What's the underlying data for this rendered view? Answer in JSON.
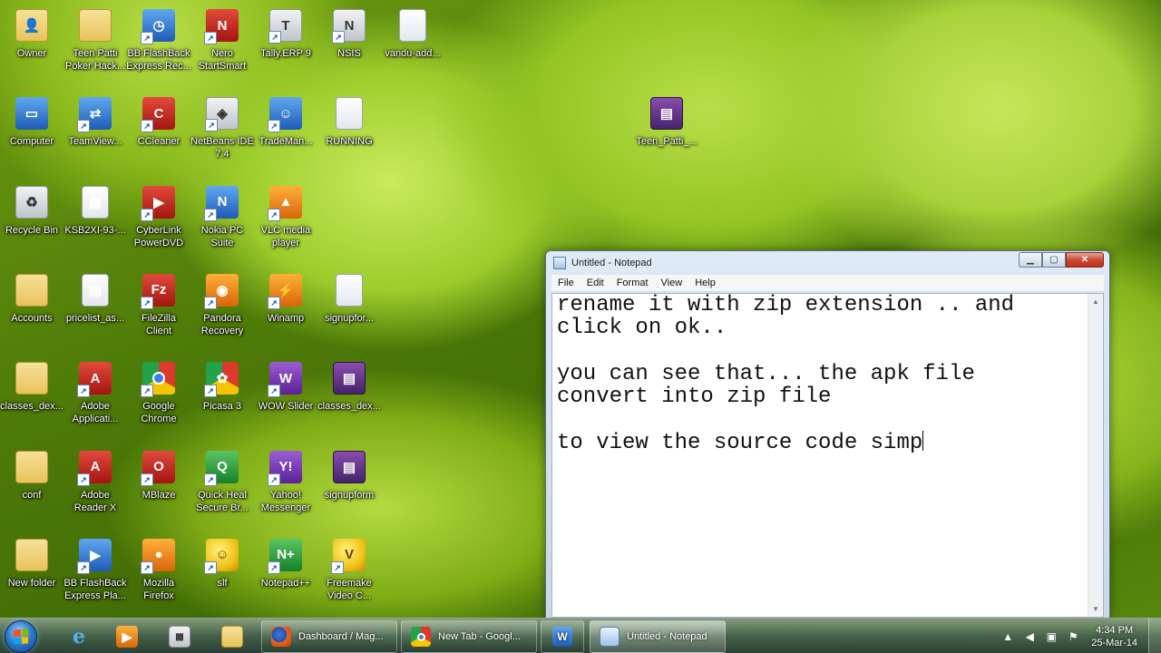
{
  "desktop": {
    "icons": [
      {
        "label": "Owner",
        "icon": "user-folder-icon"
      },
      {
        "label": "Teen Patti\nPoker Hack...",
        "icon": "folder-icon"
      },
      {
        "label": "BB FlashBack\nExpress Rec...",
        "icon": "flashback-recorder-icon"
      },
      {
        "label": "Nero\nStartSmart",
        "icon": "nero-icon"
      },
      {
        "label": "Tally.ERP 9",
        "icon": "tally-icon"
      },
      {
        "label": "NSIS",
        "icon": "nsis-icon"
      },
      {
        "label": "vandu-add...",
        "icon": "text-file-icon"
      },
      {
        "label": "Computer",
        "icon": "computer-icon"
      },
      {
        "label": "TeamView...",
        "icon": "teamviewer-icon"
      },
      {
        "label": "CCleaner",
        "icon": "ccleaner-icon"
      },
      {
        "label": "NetBeans IDE\n7.4",
        "icon": "netbeans-icon"
      },
      {
        "label": "TradeMan...",
        "icon": "trademanager-icon"
      },
      {
        "label": "RUNNING",
        "icon": "text-file-icon"
      },
      {
        "label": "Teen_Patti_...",
        "icon": "winrar-archive-icon"
      },
      {
        "label": "Recycle Bin",
        "icon": "recycle-bin-icon"
      },
      {
        "label": "KSB2XI-93-...",
        "icon": "image-file-icon"
      },
      {
        "label": "CyberLink\nPowerDVD",
        "icon": "powerdvd-icon"
      },
      {
        "label": "Nokia PC\nSuite",
        "icon": "nokia-pc-suite-icon"
      },
      {
        "label": "VLC media\nplayer",
        "icon": "vlc-icon"
      },
      {
        "label": "Accounts",
        "icon": "folder-icon"
      },
      {
        "label": "pricelist_as...",
        "icon": "spreadsheet-icon"
      },
      {
        "label": "FileZilla\nClient",
        "icon": "filezilla-icon"
      },
      {
        "label": "Pandora\nRecovery",
        "icon": "pandora-recovery-icon"
      },
      {
        "label": "Winamp",
        "icon": "winamp-icon"
      },
      {
        "label": "signupfor...",
        "icon": "text-file-icon"
      },
      {
        "label": "classes_dex...",
        "icon": "folder-icon"
      },
      {
        "label": "Adobe\nApplicati...",
        "icon": "adobe-icon"
      },
      {
        "label": "Google\nChrome",
        "icon": "chrome-icon"
      },
      {
        "label": "Picasa 3",
        "icon": "picasa-icon"
      },
      {
        "label": "WOW Slider",
        "icon": "wow-slider-icon"
      },
      {
        "label": "classes_dex...",
        "icon": "winrar-archive-icon"
      },
      {
        "label": "conf",
        "icon": "folder-icon"
      },
      {
        "label": "Adobe\nReader X",
        "icon": "adobe-reader-icon"
      },
      {
        "label": "MBlaze",
        "icon": "mblaze-icon"
      },
      {
        "label": "Quick Heal\nSecure Br...",
        "icon": "quick-heal-icon"
      },
      {
        "label": "Yahoo!\nMessenger",
        "icon": "yahoo-messenger-icon"
      },
      {
        "label": "signupform",
        "icon": "winrar-archive-icon"
      },
      {
        "label": "New folder",
        "icon": "folder-icon"
      },
      {
        "label": "BB FlashBack\nExpress Pla...",
        "icon": "flashback-player-icon"
      },
      {
        "label": "Mozilla\nFirefox",
        "icon": "firefox-icon"
      },
      {
        "label": "slf",
        "icon": "smiley-icon"
      },
      {
        "label": "Notepad++",
        "icon": "notepad-plus-plus-icon"
      },
      {
        "label": "Freemake\nVideo C...",
        "icon": "freemake-icon"
      }
    ]
  },
  "notepad": {
    "title": "Untitled - Notepad",
    "menu": [
      "File",
      "Edit",
      "Format",
      "View",
      "Help"
    ],
    "lines": [
      "rename it with zip extension .. and",
      "click on ok..",
      "",
      "you can see that... the apk file",
      "convert into zip file",
      "",
      "to view the source code simp"
    ]
  },
  "taskbar": {
    "pinned": [
      "internet-explorer-icon",
      "media-player-icon",
      "calculator-icon",
      "explorer-folder-icon"
    ],
    "tasks": [
      {
        "label": "Dashboard / Mag...",
        "icon": "firefox-icon"
      },
      {
        "label": "New Tab - Googl...",
        "icon": "chrome-icon"
      },
      {
        "label": "",
        "icon": "word-icon"
      },
      {
        "label": "Untitled - Notepad",
        "icon": "notepad-icon"
      }
    ],
    "clock": {
      "time": "4:34 PM",
      "date": "25-Mar-14"
    }
  }
}
